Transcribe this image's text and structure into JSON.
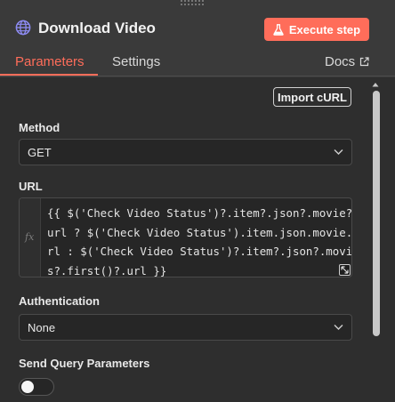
{
  "header": {
    "title": "Download Video",
    "execute_label": "Execute step"
  },
  "tabs": [
    {
      "label": "Parameters",
      "active": true
    },
    {
      "label": "Settings",
      "active": false
    }
  ],
  "docs_label": "Docs",
  "import_curl_label": "Import cURL",
  "method": {
    "label": "Method",
    "value": "GET"
  },
  "url": {
    "label": "URL",
    "fx_label": "fx",
    "lines": [
      "{{ $('Check Video Status')?.item?.json?.movie?.",
      "url ? $('Check Video Status').item.json.movie.u",
      "rl : $('Check Video Status')?.item?.json?.movie",
      "s?.first()?.url }}"
    ]
  },
  "authentication": {
    "label": "Authentication",
    "value": "None"
  },
  "send_query": {
    "label": "Send Query Parameters",
    "enabled": false
  },
  "colors": {
    "accent": "#ff6d5a",
    "globe": "#8e8cf4",
    "panel": "#3a3a3a",
    "content": "#2e2e2e",
    "input": "#262626"
  },
  "icons": {
    "node": "globe-icon",
    "execute": "flask-icon",
    "docs": "external-link-icon",
    "select": "chevron-down-icon",
    "expand": "expand-icon"
  }
}
